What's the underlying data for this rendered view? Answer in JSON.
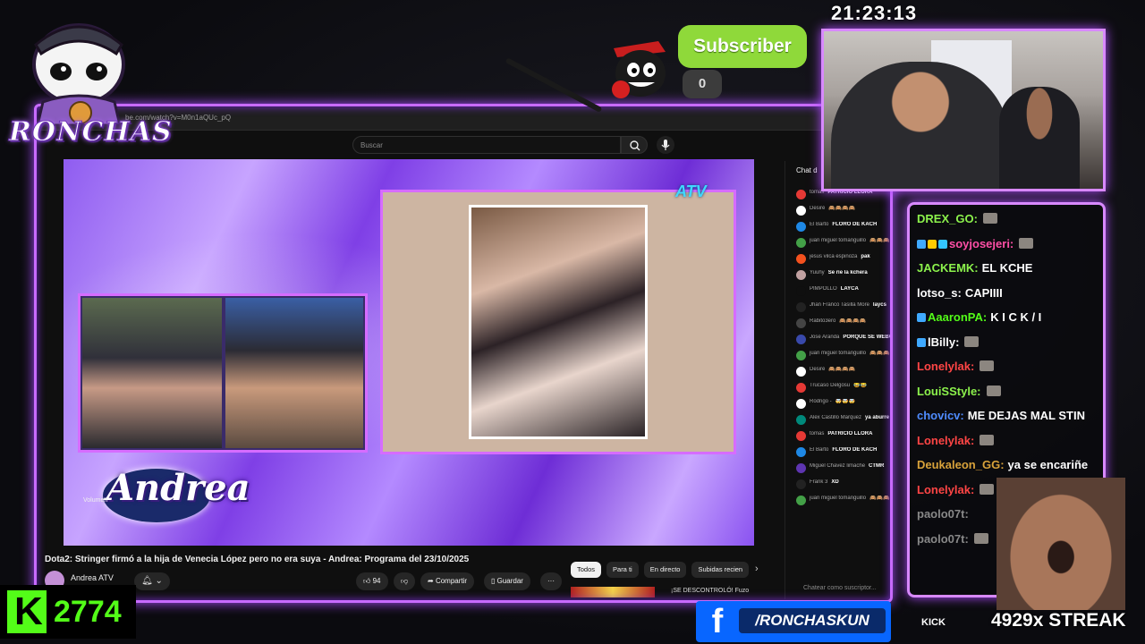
{
  "overlay": {
    "logo_text": "RONCHAS",
    "clock": "21:23:13",
    "subscriber_label": "Subscriber",
    "subscriber_count": "0",
    "kick_follower_count": "2774",
    "facebook_handle": "/RONCHASKUN",
    "social_label": "KICK",
    "streak": "4929x STREAK",
    "accent_color": "#c86bff",
    "kick_color": "#53fc18",
    "facebook_color": "#0866ff"
  },
  "browser": {
    "url": "be.com/watch?v=M0n1aQUc_pQ"
  },
  "youtube": {
    "search_placeholder": "Buscar",
    "video": {
      "network_logo": "ATV",
      "show_logo": "Andrea",
      "volume_label": "Volumen"
    },
    "title": "Dota2: Stringer firmó a la hija de Venecia López pero no era suya - Andrea: Programa del 23/10/2025",
    "channel": "Andrea ATV",
    "likes": "94",
    "share_label": "Compartir",
    "save_label": "Guardar",
    "more_label": "···",
    "chips": [
      "Todos",
      "Para ti",
      "En directo",
      "Subidas recien"
    ],
    "recommendation_text": "¡SE DESCONTROLÓ! Fuzo",
    "chat": {
      "header": "Chat d",
      "input_placeholder": "Chatear como suscriptor...",
      "messages": [
        {
          "user": "tomas",
          "text": "PATRICIO LLORA",
          "color": "#e53935"
        },
        {
          "user": "Desiré",
          "text": "🙈🙈🙈🙈",
          "color": "#ffffff"
        },
        {
          "user": "El Barto",
          "text": "FLORO DE KACH",
          "color": "#1e88e5"
        },
        {
          "user": "juan miguel tomanguillo",
          "text": "🙈🙈🙈",
          "color": "#43a047"
        },
        {
          "user": "jesus vilca espinoza",
          "text": "pak",
          "color": "#f4511e"
        },
        {
          "user": "Yuuhy",
          "text": "Se ríe la kchera",
          "color": "#c0a0a0"
        },
        {
          "user": "PIMPOLLO",
          "text": "LAYCA",
          "color": "#0f0f0f"
        },
        {
          "user": "Jhan Franco Tasilla More",
          "text": "laycs",
          "color": "#222222"
        },
        {
          "user": "Rabito3ero",
          "text": "🙈🙈🙈🙈",
          "color": "#444444"
        },
        {
          "user": "Jose Aranda",
          "text": "PORQUE SE WEBOON",
          "color": "#3949ab"
        },
        {
          "user": "juan miguel tomanguillo",
          "text": "🙈🙈🙈🙈🙈",
          "color": "#43a047"
        },
        {
          "user": "Desiré",
          "text": "🙈🙈🙈🙈",
          "color": "#ffffff"
        },
        {
          "user": "Trucaso Delgosu",
          "text": "😂😂",
          "color": "#e53935"
        },
        {
          "user": "Rodrigo -",
          "text": "🤯🤯🤯",
          "color": "#ffffff"
        },
        {
          "user": "Alex Castillo Marquez",
          "text": "ya aburre",
          "color": "#00897b"
        },
        {
          "user": "tomas",
          "text": "PATRICIO LLORA",
          "color": "#e53935"
        },
        {
          "user": "El Barto",
          "text": "FLORO DE KACH",
          "color": "#1e88e5"
        },
        {
          "user": "Miguel Chavez limache",
          "text": "CTMR",
          "color": "#5e35b1"
        },
        {
          "user": "Frank 3",
          "text": "XD",
          "color": "#222222"
        },
        {
          "user": "juan miguel tomanguillo",
          "text": "🙈🙈🙈🙈🙈",
          "color": "#43a047"
        }
      ]
    }
  },
  "kick_chat": {
    "messages": [
      {
        "user": "DREX_GO:",
        "text": "",
        "color": "#8cf24c",
        "emote": true
      },
      {
        "user": "soyjosejeri:",
        "text": "",
        "color": "#ff4fa6",
        "emote": true,
        "badges": 3
      },
      {
        "user": "JACKEMK:",
        "text": "EL KCHE",
        "color": "#8cf24c"
      },
      {
        "user": "lotso_s:",
        "text": "CAPIIII",
        "color": "#ffffff"
      },
      {
        "user": "AaaronPA:",
        "text": "K I C K / I",
        "color": "#53fc18",
        "badges": 1
      },
      {
        "user": "lBilly:",
        "text": "",
        "color": "#ffffff",
        "emote": true,
        "badges": 1
      },
      {
        "user": "Lonelylak:",
        "text": "",
        "color": "#ff4545",
        "emote": true
      },
      {
        "user": "LouiSStyle:",
        "text": "",
        "color": "#8cf24c",
        "emote": true
      },
      {
        "user": "chovicv:",
        "text": "ME DEJAS MAL STIN",
        "color": "#4f8cff"
      },
      {
        "user": "Lonelylak:",
        "text": "",
        "color": "#ff4545",
        "emote": true
      },
      {
        "user": "Deukaleon_GG:",
        "text": "ya se encariñe",
        "color": "#d8a23a"
      },
      {
        "user": "Lonelylak:",
        "text": "",
        "color": "#ff4545",
        "emote": true
      },
      {
        "user": "paolo07t:",
        "text": "",
        "color": "#888888"
      },
      {
        "user": "paolo07t:",
        "text": "",
        "color": "#888888",
        "emote": true
      }
    ]
  }
}
